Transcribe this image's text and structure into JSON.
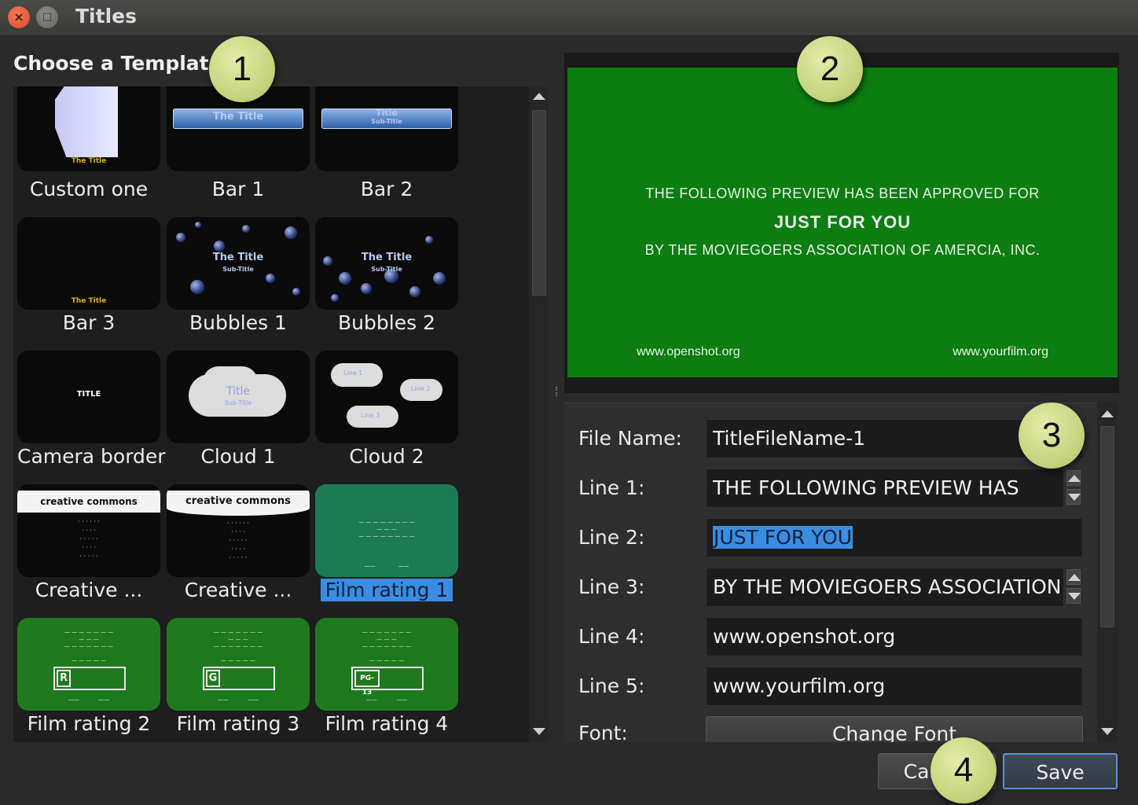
{
  "window": {
    "title": "Titles"
  },
  "left": {
    "heading": "Choose a Template",
    "templates": [
      {
        "label": "Custom one",
        "thumb_text": "The Title"
      },
      {
        "label": "Bar 1",
        "thumb_text": "The Title"
      },
      {
        "label": "Bar 2",
        "thumb_text": "Title",
        "thumb_sub": "Sub-Title"
      },
      {
        "label": "Bar 3",
        "thumb_text": "The Title"
      },
      {
        "label": "Bubbles 1",
        "thumb_text": "The Title",
        "thumb_sub": "Sub-Title"
      },
      {
        "label": "Bubbles 2",
        "thumb_text": "The Title",
        "thumb_sub": "Sub-Title"
      },
      {
        "label": "Camera border",
        "thumb_text": "TITLE"
      },
      {
        "label": "Cloud 1",
        "thumb_text": "Title",
        "thumb_sub": "Sub-Title"
      },
      {
        "label": "Cloud 2",
        "thumb_text": "Line 1",
        "thumb_sub": "Line 2",
        "thumb_extra": "Line 3"
      },
      {
        "label": "Creative ...",
        "thumb_text": "creative commons"
      },
      {
        "label": "Creative ...",
        "thumb_text": "creative commons"
      },
      {
        "label": "Film rating 1",
        "selected": true
      },
      {
        "label": "Film rating 2",
        "rating": "R"
      },
      {
        "label": "Film rating 3",
        "rating": "G"
      },
      {
        "label": "Film rating 4",
        "rating": "PG-13"
      }
    ]
  },
  "preview": {
    "line1": "THE FOLLOWING PREVIEW HAS BEEN APPROVED FOR",
    "line2": "JUST FOR YOU",
    "line3": "BY THE MOVIEGOERS ASSOCIATION OF AMERCIA, INC.",
    "line4": "www.openshot.org",
    "line5": "www.yourfilm.org",
    "background_color": "#0c7d10"
  },
  "form": {
    "file_name_label": "File Name:",
    "file_name_value": "TitleFileName-1",
    "line1_label": "Line 1:",
    "line1_value": "THE FOLLOWING PREVIEW HAS",
    "line2_label": "Line 2:",
    "line2_value": "JUST FOR YOU",
    "line3_label": "Line 3:",
    "line3_value": "BY THE MOVIEGOERS ASSOCIATION",
    "line4_label": "Line 4:",
    "line4_value": "www.openshot.org",
    "line5_label": "Line 5:",
    "line5_value": "www.yourfilm.org",
    "font_label": "Font:",
    "change_font": "Change Font"
  },
  "buttons": {
    "cancel": "Cancel",
    "save": "Save"
  },
  "callouts": [
    "1",
    "2",
    "3",
    "4"
  ]
}
